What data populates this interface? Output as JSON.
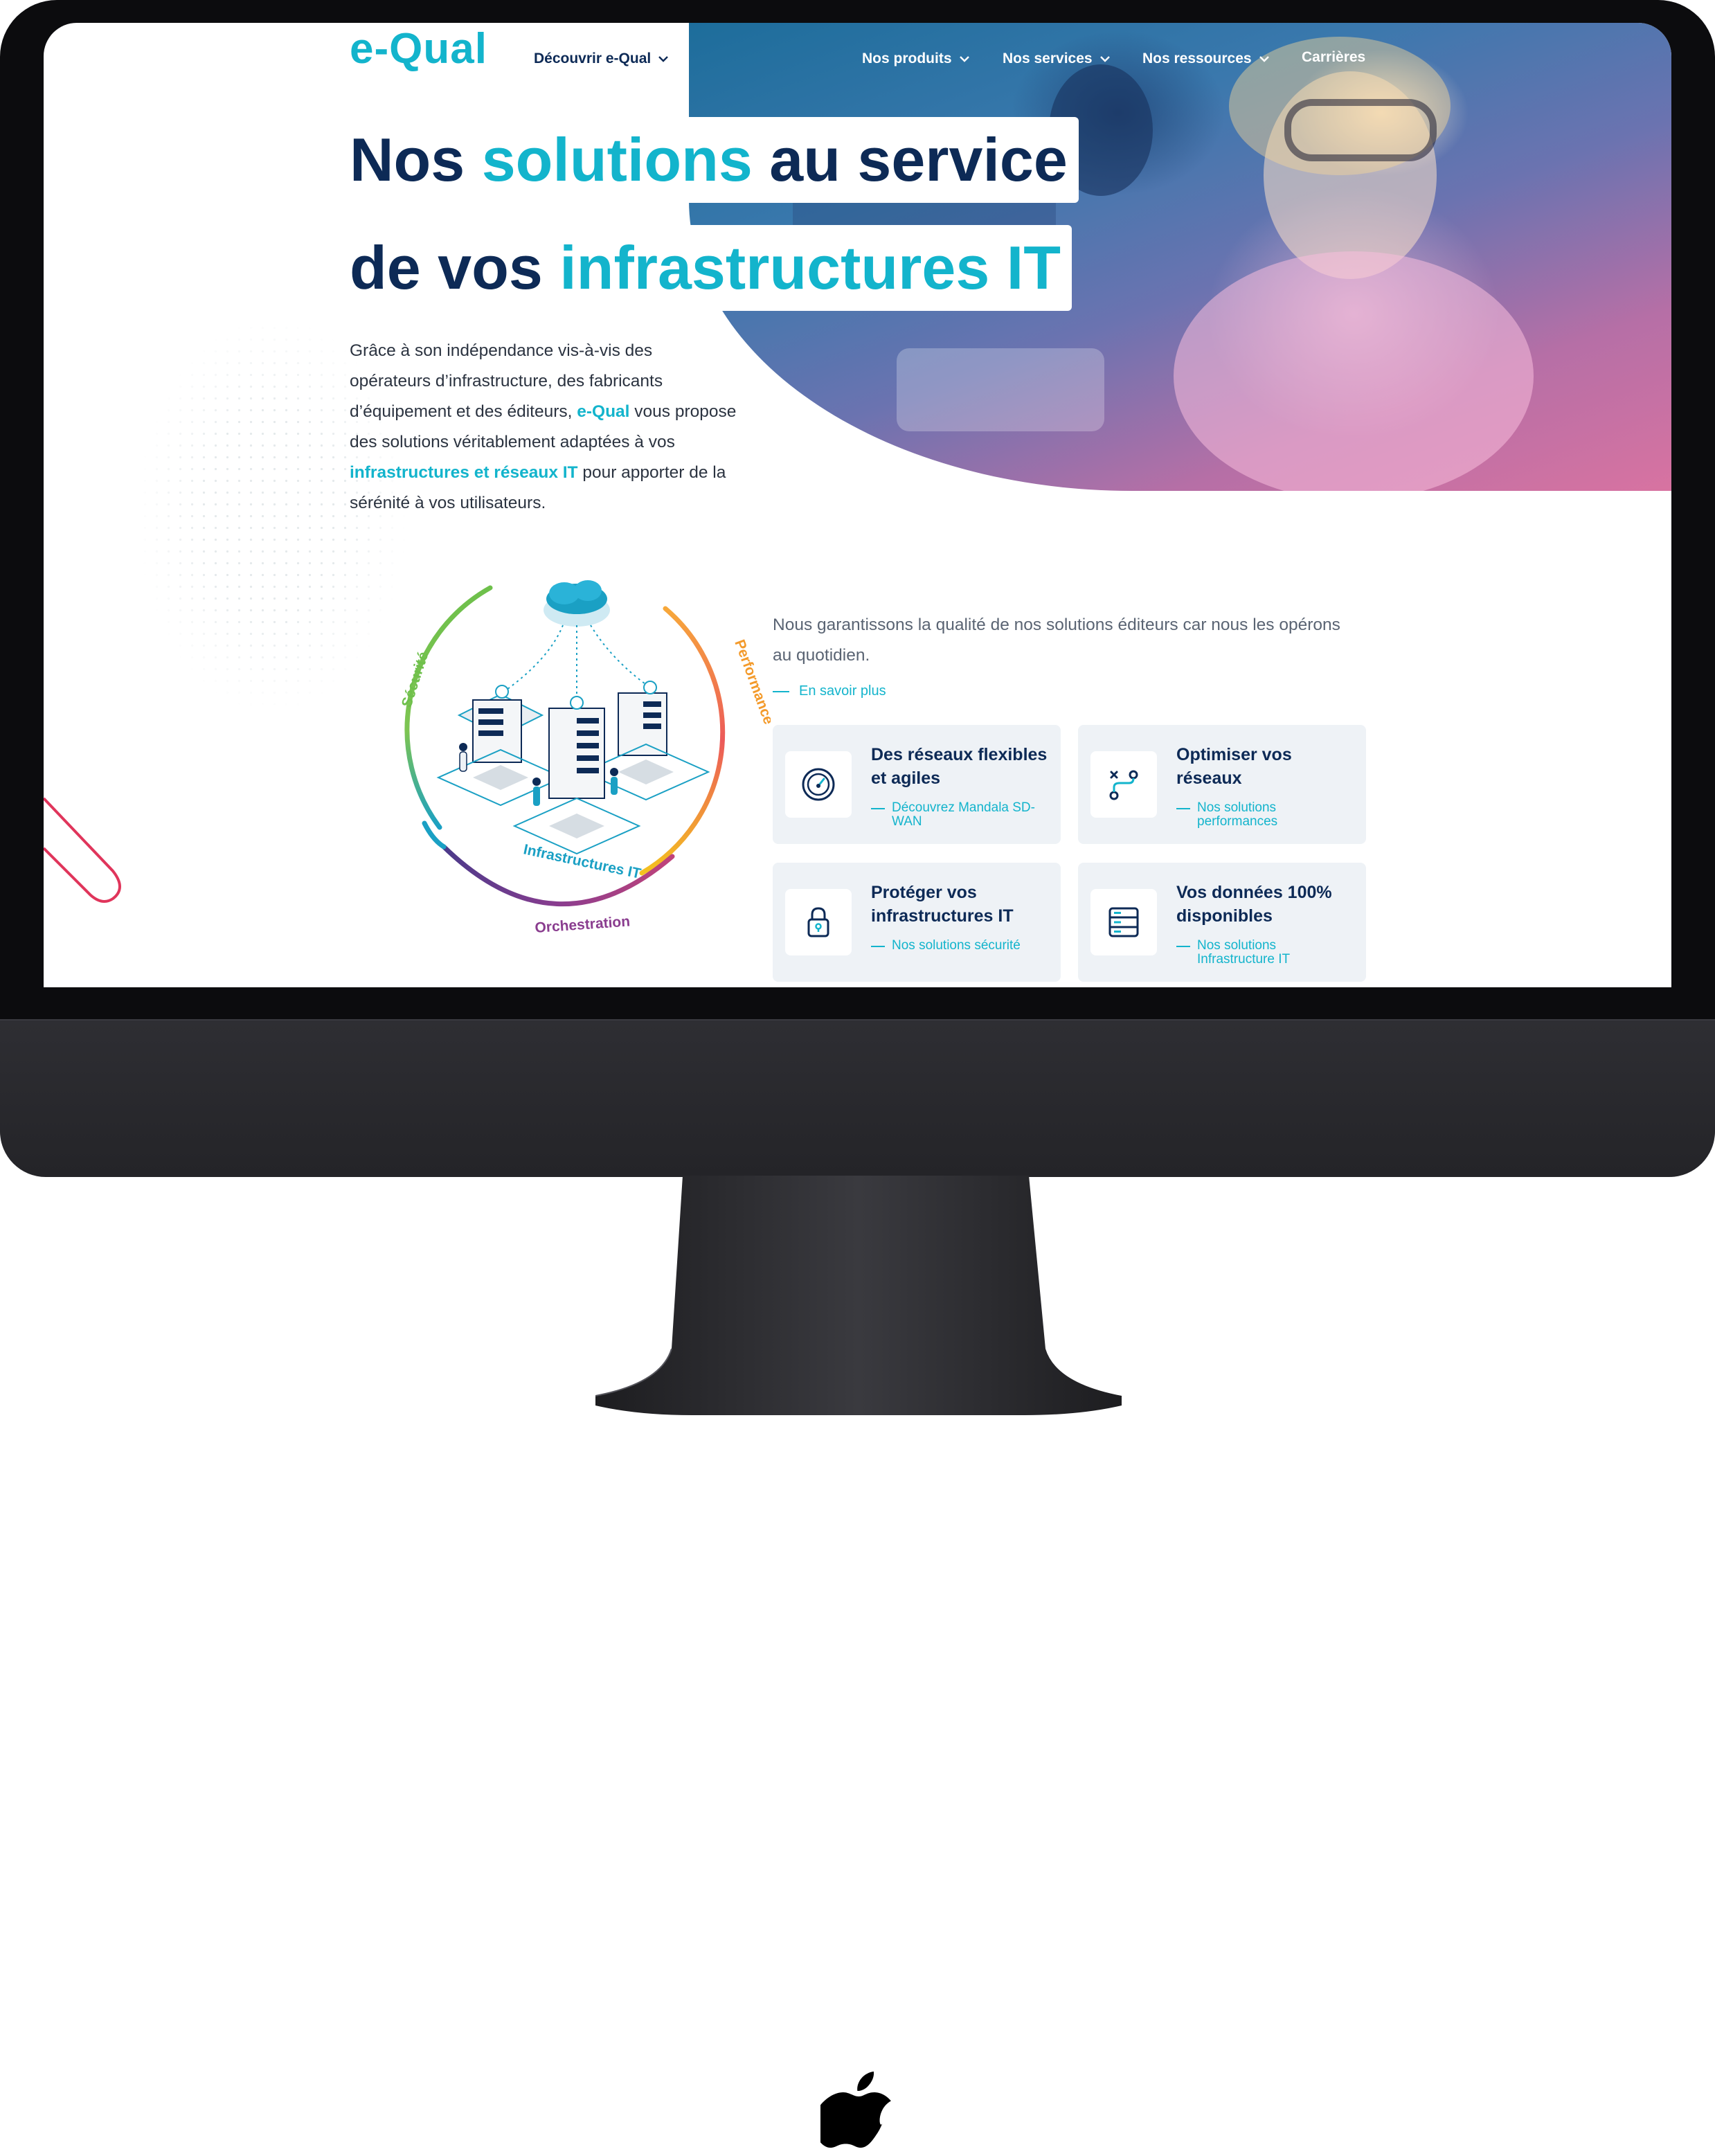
{
  "brand": {
    "logo": "e-Qual",
    "accent": "#13b4cc",
    "navy": "#0d2a56"
  },
  "nav": {
    "discover": "Découvrir  e-Qual",
    "products": "Nos produits",
    "services": "Nos services",
    "resources": "Nos ressources",
    "careers": "Carrières"
  },
  "hero": {
    "line1_a": "Nos ",
    "line1_b": "solutions",
    "line1_c": " au service",
    "line2_a": "de vos ",
    "line2_b": "infrastructures IT"
  },
  "intro": {
    "part1": "Grâce à son indépendance vis-à-vis des opérateurs d’infrastructure, des fabricants d’équipement et des éditeurs, ",
    "brand": "e-Qual",
    "part2": " vous propose des solutions véritablement adaptées à vos ",
    "highlight": "infrastructures et réseaux IT",
    "part3": " pour apporter de la sérénité à vos utilisateurs."
  },
  "diagram": {
    "labels": {
      "security": "Sécurité",
      "performance": "Performance",
      "infrastructures": "Infrastructures IT",
      "orchestration": "Orchestration"
    },
    "colors": {
      "security": "#6ec04b",
      "performance": "#f39a2b",
      "infra": "#1aa0c4",
      "orchestration": "#8a3d8f"
    }
  },
  "section": {
    "guarantee": "Nous garantissons la qualité de nos solutions éditeurs car nous les opérons au quotidien.",
    "learn_more": "En savoir plus"
  },
  "cards": [
    {
      "title": "Des réseaux flexibles et agiles",
      "link": "Découvrez Mandala SD-WAN",
      "icon": "speedometer-icon"
    },
    {
      "title": "Optimiser vos réseaux",
      "link": "Nos solutions performances",
      "icon": "route-icon"
    },
    {
      "title": "Protéger vos infrastructures IT",
      "link": "Nos solutions sécurité",
      "icon": "lock-icon"
    },
    {
      "title": "Vos données 100% disponibles",
      "link": "Nos solutions Infrastructure IT",
      "icon": "server-icon"
    }
  ]
}
